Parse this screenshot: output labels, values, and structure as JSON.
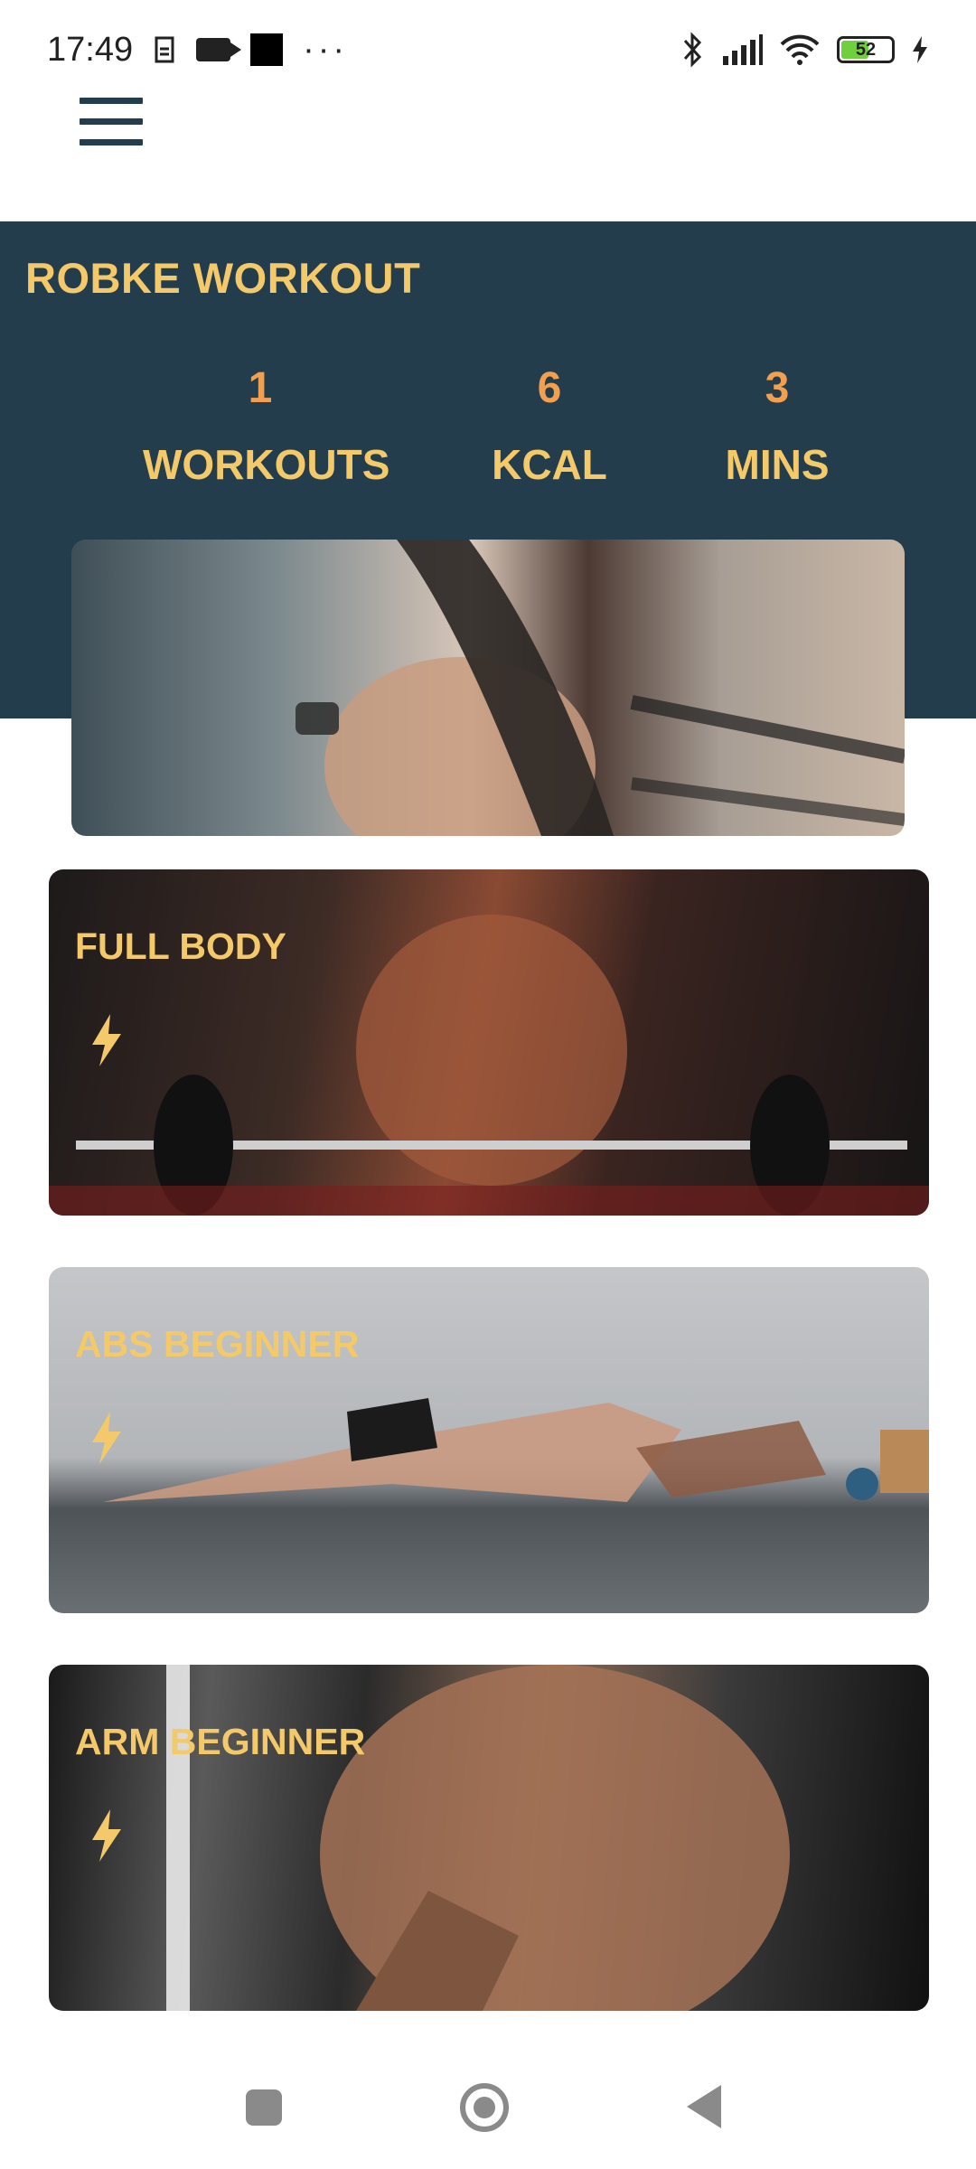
{
  "status_bar": {
    "time": "17:49",
    "dots": "···",
    "battery": "52"
  },
  "app": {
    "title": "ROBKE WORKOUT"
  },
  "stats": [
    {
      "value": "1",
      "label": "WORKOUTS"
    },
    {
      "value": "6",
      "label": "KCAL"
    },
    {
      "value": "3",
      "label": "MINS"
    }
  ],
  "workouts": [
    {
      "title": "FULL BODY"
    },
    {
      "title": "ABS BEGINNER"
    },
    {
      "title": "ARM BEGINNER"
    }
  ],
  "colors": {
    "header_bg": "#233d4d",
    "title_yellow": "#f3c969",
    "stat_orange": "#f0a050"
  },
  "icons": [
    "menu-icon",
    "bolt-icon",
    "recent-apps-icon",
    "home-icon",
    "back-icon"
  ]
}
